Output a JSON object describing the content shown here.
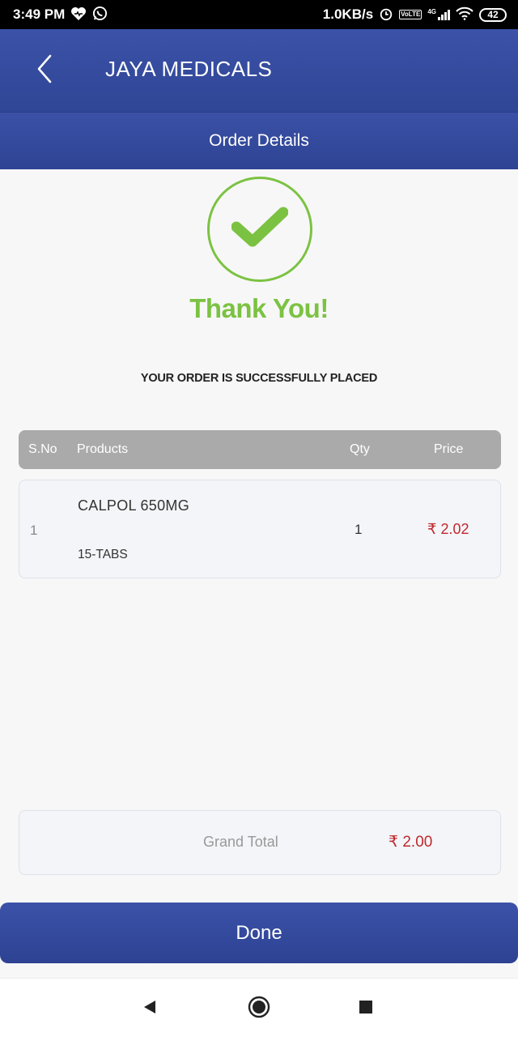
{
  "status_bar": {
    "time": "3:49 PM",
    "net_speed": "1.0KB/s",
    "volte_tag": "VoLTE",
    "network_label": "4G",
    "battery": "42"
  },
  "app_bar": {
    "title": "JAYA MEDICALS"
  },
  "sub_header": {
    "title": "Order Details"
  },
  "success": {
    "thank_you": "Thank You!",
    "message": "YOUR ORDER IS SUCCESSFULLY PLACED",
    "accent_color": "#7cc242"
  },
  "table": {
    "headers": {
      "sno": "S.No",
      "products": "Products",
      "qty": "Qty",
      "price": "Price"
    },
    "rows": [
      {
        "sno": "1",
        "product": "CALPOL 650MG",
        "size": "15-TABS",
        "qty": "1",
        "price": "₹ 2.02"
      }
    ]
  },
  "total": {
    "label": "Grand Total",
    "value": "₹ 2.00"
  },
  "done_button": {
    "label": "Done"
  },
  "colors": {
    "primary": "#3249a0",
    "price": "#c0282e"
  }
}
